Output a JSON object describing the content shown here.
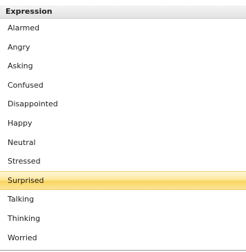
{
  "top_marker": "\"",
  "list": {
    "header": "Expression",
    "selected_index": 8,
    "items": [
      {
        "label": "Alarmed"
      },
      {
        "label": "Angry"
      },
      {
        "label": "Asking"
      },
      {
        "label": "Confused"
      },
      {
        "label": "Disappointed"
      },
      {
        "label": "Happy"
      },
      {
        "label": "Neutral"
      },
      {
        "label": "Stressed"
      },
      {
        "label": "Surprised"
      },
      {
        "label": "Talking"
      },
      {
        "label": "Thinking"
      },
      {
        "label": "Worried"
      }
    ]
  },
  "colors": {
    "selection": "#fbe08a",
    "header_bg": "#e9e9e9"
  }
}
